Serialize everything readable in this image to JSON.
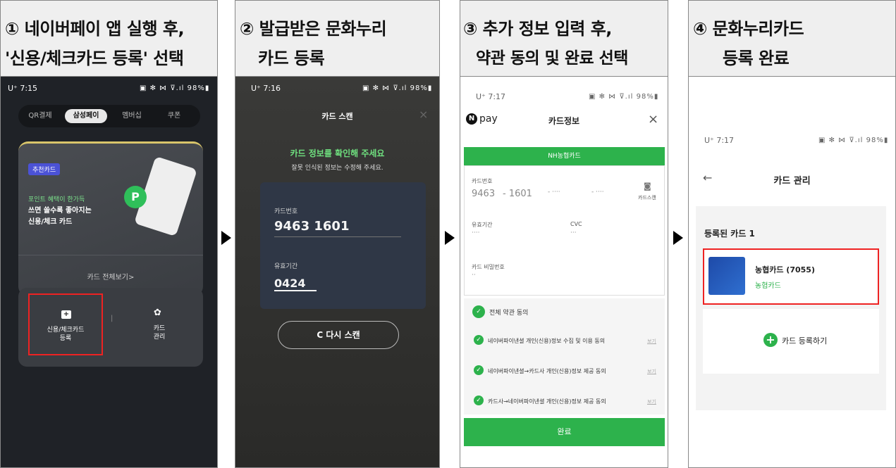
{
  "steps": [
    {
      "title_line1": "① 네이버페이 앱 실행 후,",
      "title_line2": "'신용/체크카드 등록' 선택"
    },
    {
      "title_line1": "② 발급받은 문화누리",
      "title_line2": "카드 등록"
    },
    {
      "title_line1": "③ 추가 정보 입력 후,",
      "title_line2": "약관 동의 및 완료 선택"
    },
    {
      "title_line1": "④ 문화누리카드",
      "title_line2": "등록 완료"
    }
  ],
  "p1": {
    "time": "U⁺ 7:15",
    "status": "▣ ✻ ⋈ ⊽.ıl 98%▮",
    "tabs": [
      "QR결제",
      "삼성페이",
      "멤버십",
      "쿠폰"
    ],
    "active_tab": "삼성페이",
    "badge": "추천카드",
    "promo_line1": "포인트 혜택이 한가득",
    "promo_line2": "쓰면 쓸수록 좋아지는",
    "promo_line3": "신용/체크 카드",
    "promo_coin": "P",
    "view_all": "카드 전체보기>",
    "register_label1": "신용/체크카드",
    "register_label2": "등록",
    "register_icon": "+",
    "manage_label1": "카드",
    "manage_label2": "관리",
    "manage_icon": "✿",
    "divider": "|"
  },
  "p2": {
    "time": "U⁺ 7:16",
    "status": "▣ ✻ ⋈ ⊽.ıl 98%▮",
    "title": "카드 스캔",
    "close": "×",
    "headline": "카드 정보를 확인해 주세요",
    "sub": "잘못 인식된 정보는 수정해 주세요.",
    "card_num_label": "카드번호",
    "card_num": "9463 1601",
    "expiry_label": "유효기간",
    "expiry": "0424",
    "rescan": "C 다시 스캔"
  },
  "p3": {
    "time": "U⁺ 7:17",
    "status": "▣ ✻ ⋈ ⊽.ıl 98%▮",
    "logo": "pay",
    "title": "카드정보",
    "close": "×",
    "bank": "NH농협카드",
    "card_num_label": "카드번호",
    "n1": "9463",
    "n2": "- 1601",
    "n3": "- ····",
    "n4": "- ····",
    "scan": "카드스캔",
    "exp_label": "유효기간",
    "exp_val": "····",
    "cvc_label": "CVC",
    "cvc_val": "···",
    "pw_label": "카드 비밀번호",
    "pw_val": "··",
    "agree_all": "전체 약관 동의",
    "agree1": "네이버파이낸셜 개인(신용)정보 수집 및 이용 동의",
    "agree2": "네이버파이낸셜→카드사 개인(신용)정보 제공 동의",
    "agree3": "카드사→네이버파이낸셜 개인(신용)정보 제공 동의",
    "view": "보기",
    "done": "완료"
  },
  "p4": {
    "time": "U⁺ 7:17",
    "status": "▣ ✻ ⋈ ⊽.ıl 98%▮",
    "back": "←",
    "title": "카드 관리",
    "registered": "등록된 카드 1",
    "card_name": "농협카드 (7055)",
    "card_bank": "농협카드",
    "add": "카드 등록하기"
  }
}
